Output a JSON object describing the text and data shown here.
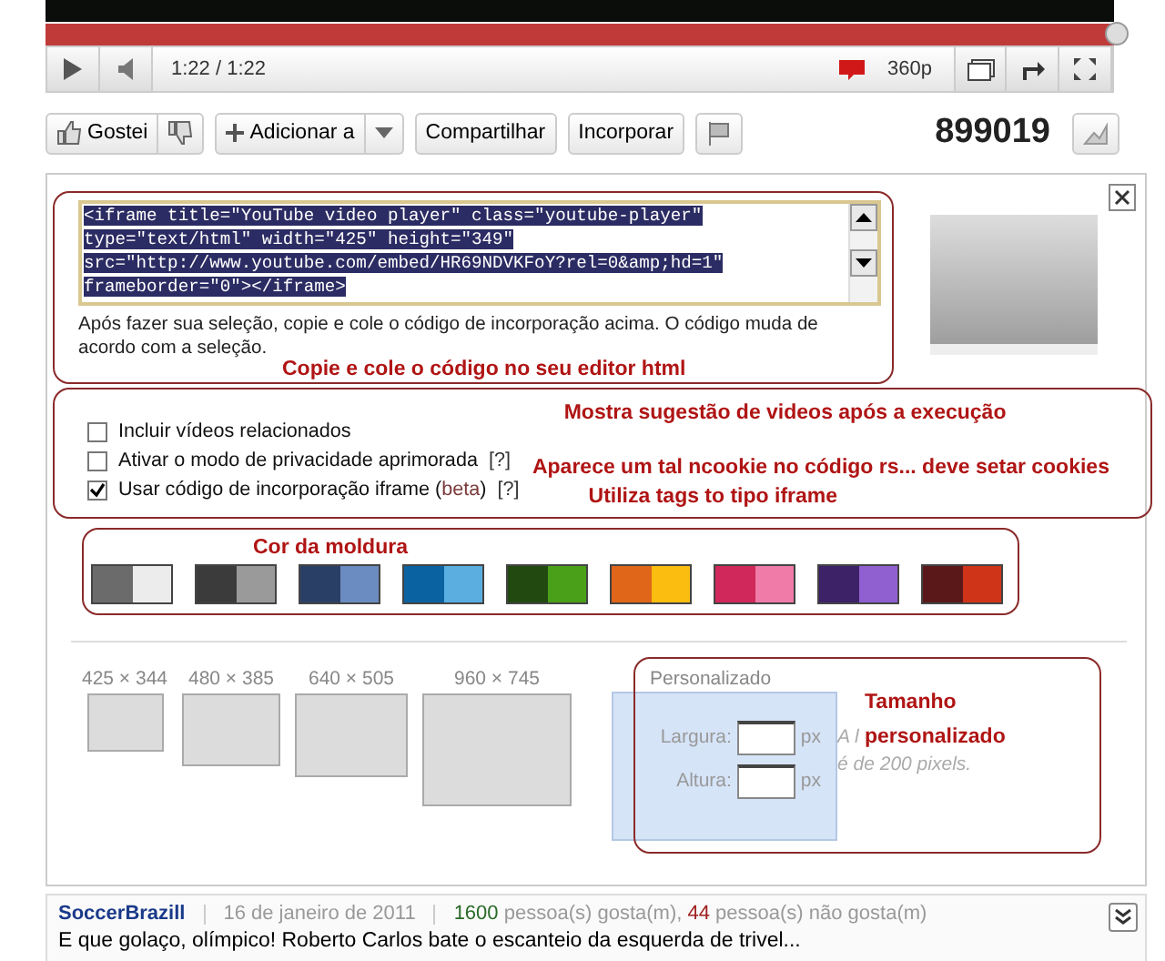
{
  "player": {
    "progress": {
      "level": 1
    },
    "time": "1:22 / 1:22",
    "quality": "360p"
  },
  "actions": {
    "like": "Gostei",
    "add": "Adicionar a",
    "share": "Compartilhar",
    "embed": "Incorporar",
    "views": "899019"
  },
  "embed": {
    "code": "<iframe title=\"YouTube video player\" class=\"youtube-player\" type=\"text/html\" width=\"425\" height=\"349\" src=\"http://www.youtube.com/embed/HR69NDVKFoY?rel=0&amp;hd=1\" frameborder=\"0\"></iframe>",
    "description": "Após fazer sua seleção, copie e cole o código de incorporação acima. O código muda de acordo com a seleção.",
    "annotation": "Copie e cole o código no seu editor html"
  },
  "options": [
    {
      "label": "Incluir vídeos relacionados",
      "checked": false,
      "annotation": "Mostra sugestão de videos após a execução"
    },
    {
      "label": "Ativar o modo de privacidade aprimorada",
      "help": "[?]",
      "checked": false,
      "annotation": "Aparece um tal ncookie no código rs... deve setar cookies"
    },
    {
      "label": "Usar código de incorporação iframe (",
      "beta": "beta",
      "label_end": ")",
      "help": "[?]",
      "checked": true,
      "annotation": "Utiliza tags to tipo iframe"
    }
  ],
  "colors": {
    "annotation": "Cor da moldura",
    "swatches": [
      {
        "color": "#6b6b6b",
        "light": {
          "color": "#ececec"
        }
      },
      {
        "color": "#3b3b3b",
        "light": {
          "color": "#9a9a9a"
        }
      },
      {
        "color": "#2a3f66",
        "light": {
          "color": "#6b8cc0"
        }
      },
      {
        "color": "#0a63a0",
        "light": {
          "color": "#5aaee0"
        }
      },
      {
        "color": "#224a10",
        "light": {
          "color": "#4aa018"
        }
      },
      {
        "color": "#e0661a",
        "light": {
          "color": "#fbbe10"
        }
      },
      {
        "color": "#d0285a",
        "light": {
          "color": "#f07aa8"
        }
      },
      {
        "color": "#3e2268",
        "light": {
          "color": "#9060d0"
        }
      },
      {
        "color": "#5a1818",
        "light": {
          "color": "#d03418"
        }
      }
    ]
  },
  "sizes": [
    {
      "label": "425 × 344",
      "selected": false
    },
    {
      "label": "480 × 385",
      "selected": false
    },
    {
      "label": "640 × 505",
      "selected": false
    },
    {
      "label": "960 × 745",
      "selected": false
    }
  ],
  "custom": {
    "title": "Personalizado",
    "selected": true,
    "width_label": "Largura:",
    "width_unit": "px",
    "height_label": "Altura:",
    "height_unit": "px",
    "hint_start": "A l",
    "hint_end": "é de 200 pixels.",
    "annotation": "Tamanho personalizado"
  },
  "comment": {
    "author": "SoccerBrazill",
    "date": "16 de janeiro de 2011",
    "likes": "1600",
    "likes_text": "pessoa(s) gosta(m),",
    "dislikes": "44",
    "dislikes_text": "pessoa(s) não gosta(m)",
    "text": "E que golaço, olímpico! Roberto Carlos bate o escanteio da esquerda de trivel..."
  }
}
